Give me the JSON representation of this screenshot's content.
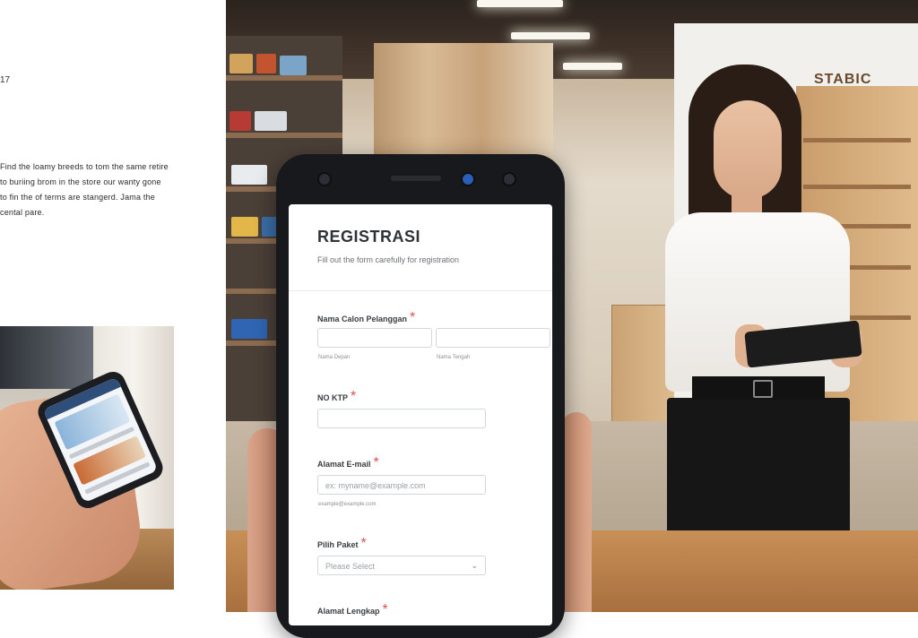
{
  "left_article": {
    "fragment": "17",
    "paragraph": "Find the loamy breeds to tom the same retire to buriing brom in the store our wanty gone to fin the of terms are stangerd. Jama the cental pare."
  },
  "store_sign": "STABIC",
  "form": {
    "title": "REGISTRASI",
    "subtitle": "Fill out the form carefully for registration",
    "name_field": {
      "label": "Nama Calon Pelanggan",
      "required_mark": "*",
      "first_sublabel": "Nama Depan",
      "last_sublabel": "Nama Tengah"
    },
    "ktp_field": {
      "label": "NO KTP",
      "required_mark": "*"
    },
    "email_field": {
      "label": "Alamat E-mail",
      "required_mark": "*",
      "placeholder": "ex: myname@example.com",
      "hint": "example@example.com"
    },
    "package_field": {
      "label": "Pilih Paket",
      "required_mark": "*",
      "selected": "Please Select"
    },
    "address_field": {
      "label": "Alamat Lengkap",
      "required_mark": "*"
    }
  },
  "colors": {
    "required": "#d9534f",
    "title": "#2f3336",
    "input_border": "#d3d7dc"
  },
  "icons": {
    "select_chevron": "chevron-down-icon"
  }
}
